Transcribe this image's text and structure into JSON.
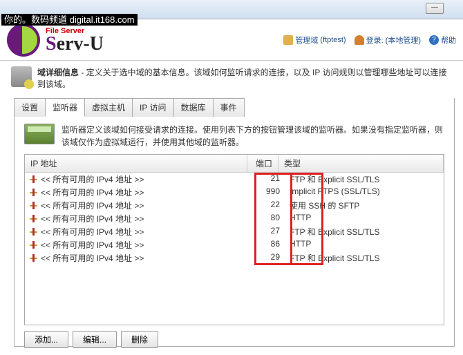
{
  "watermark": "你的。数码频道 digital.it168.com",
  "brand": {
    "fileserver": "File Server",
    "name_prefix": "S",
    "name_rest": "erv-U"
  },
  "header_links": {
    "mgmt_domain": "管理域",
    "mgmt_val": "(ftptest)",
    "login": "登录:",
    "login_val": "(本地管理)",
    "help": "帮助"
  },
  "domain_info_bold": "域详细信息",
  "domain_info_text": " - 定义关于选中域的基本信息。该域如何监听请求的连接，以及 IP 访问规则以管理哪些地址可以连接到该域。",
  "tabs": [
    "设置",
    "监听器",
    "虚拟主机",
    "IP 访问",
    "数据库",
    "事件"
  ],
  "active_tab": 1,
  "listener_desc": "监听器定义该域如何接受请求的连接。使用列表下方的按钮管理该域的监听器。如果没有指定监听器，则该域仅作为虚拟域运行，并使用其他域的监听器。",
  "columns": {
    "ip": "IP 地址",
    "port": "端口",
    "type": "类型"
  },
  "rows": [
    {
      "ip": "<< 所有可用的 IPv4 地址 >>",
      "port": "21",
      "type": "FTP 和 Explicit SSL/TLS"
    },
    {
      "ip": "<< 所有可用的 IPv4 地址 >>",
      "port": "990",
      "type": "Implicit FTPS (SSL/TLS)"
    },
    {
      "ip": "<< 所有可用的 IPv4 地址 >>",
      "port": "22",
      "type": "使用 SSH 的 SFTP"
    },
    {
      "ip": "<< 所有可用的 IPv4 地址 >>",
      "port": "80",
      "type": "HTTP"
    },
    {
      "ip": "<< 所有可用的 IPv4 地址 >>",
      "port": "27",
      "type": "FTP 和 Explicit SSL/TLS"
    },
    {
      "ip": "<< 所有可用的 IPv4 地址 >>",
      "port": "86",
      "type": "HTTP"
    },
    {
      "ip": "<< 所有可用的 IPv4 地址 >>",
      "port": "29",
      "type": "FTP 和 Explicit SSL/TLS"
    }
  ],
  "buttons": {
    "add": "添加...",
    "edit": "编辑...",
    "delete": "删除"
  }
}
